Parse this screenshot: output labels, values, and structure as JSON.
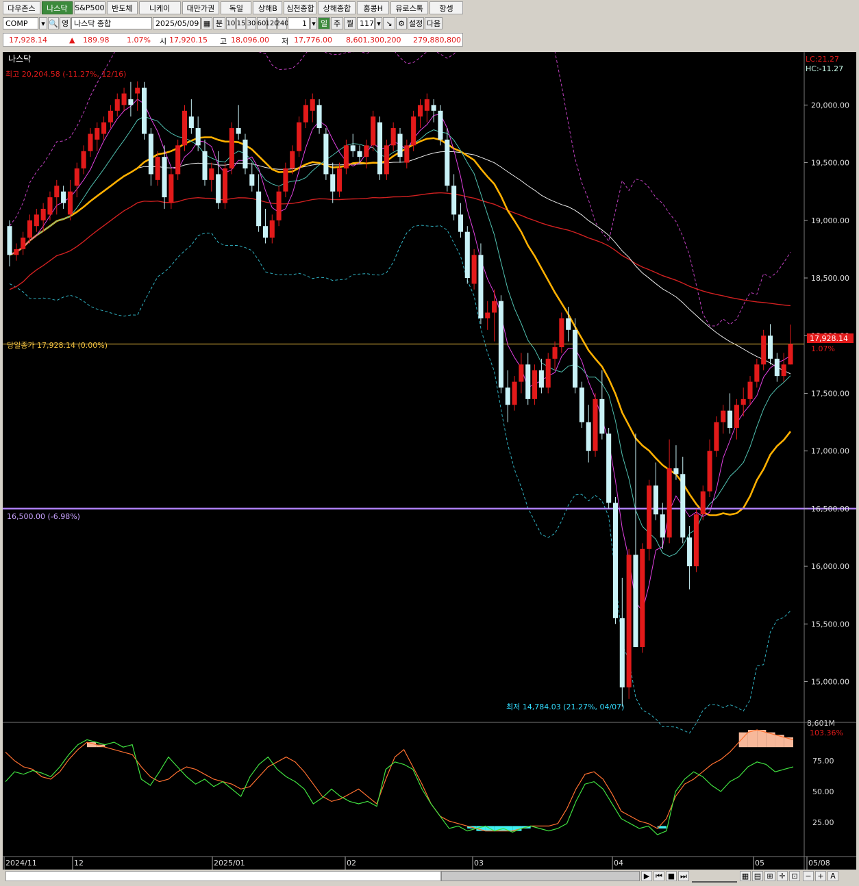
{
  "tabs": [
    {
      "label": "다우존스",
      "w": 56
    },
    {
      "label": "나스닥",
      "w": 46,
      "active": true
    },
    {
      "label": "S&P500",
      "w": 46
    },
    {
      "label": "반도체",
      "w": 46
    },
    {
      "label": "니케이",
      "w": 62
    },
    {
      "label": "대만가권",
      "w": 56
    },
    {
      "label": "독일",
      "w": 46
    },
    {
      "label": "상해B",
      "w": 44
    },
    {
      "label": "심천종합",
      "w": 48
    },
    {
      "label": "상해종합",
      "w": 56
    },
    {
      "label": "홍콩H",
      "w": 48
    },
    {
      "label": "유로스톡",
      "w": 56
    },
    {
      "label": "항셍",
      "w": 50
    }
  ],
  "controls": {
    "code": "COMP",
    "lang_label": "영",
    "name": "나스닥 종합",
    "date": "2025/05/09",
    "period_label": "분",
    "minutes": [
      "10",
      "15",
      "30",
      "60",
      "120",
      "240"
    ],
    "count": "1",
    "day_label": "일",
    "week_label": "주",
    "month_label": "월",
    "bars": "117",
    "settings_label": "설정",
    "next_label": "다음"
  },
  "quote": {
    "last": "17,928.14",
    "change": "189.98",
    "change_pct": "1.07%",
    "open_label": "시",
    "open": "17,920.15",
    "high_label": "고",
    "high": "18,096.00",
    "low_label": "저",
    "low": "17,776.00",
    "volume": "8,601,300,200",
    "value": "279,880,800"
  },
  "chart": {
    "title": "나스닥",
    "lc": "LC:21.27",
    "hc": "HC:-11.27",
    "high_note": "최고 20,204.58 (-11.27%, 12/16)",
    "low_note": "최저 14,784.03 (21.27%, 04/07)",
    "close_note": "당일종가 17,928.14 (0.00%)",
    "hline_note": "16,500.00 (-6.98%)",
    "price_tag": "17,928.14",
    "price_pct": "1.07%",
    "y_labels": [
      "20,000.00",
      "19,500.00",
      "19,000.00",
      "18,500.00",
      "18,000.00",
      "17,500.00",
      "17,000.00",
      "16,500.00",
      "16,000.00",
      "15,500.00",
      "15,000.00"
    ],
    "y_values": [
      20000,
      19500,
      19000,
      18500,
      18000,
      17500,
      17000,
      16500,
      16000,
      15500,
      15000
    ],
    "x_labels": [
      "2024/11",
      "12",
      "2025/01",
      "02",
      "03",
      "04",
      "05",
      "05/08"
    ],
    "osc_labels": [
      "75.00",
      "50.00",
      "25.00"
    ],
    "osc_top": "8,601M",
    "osc_pct": "103.36%"
  },
  "chart_data": {
    "type": "candlestick",
    "title": "나스닥",
    "ylim": [
      14700,
      20400
    ],
    "hline": 16500,
    "last_close": 17928.14,
    "candles": [
      [
        18950,
        19000,
        18600,
        18700
      ],
      [
        18700,
        18800,
        18650,
        18750
      ],
      [
        18750,
        18900,
        18700,
        18850
      ],
      [
        18850,
        19050,
        18800,
        19000
      ],
      [
        18950,
        19100,
        18900,
        19050
      ],
      [
        19000,
        19150,
        18900,
        19100
      ],
      [
        19050,
        19250,
        19000,
        19200
      ],
      [
        19200,
        19350,
        19050,
        19300
      ],
      [
        19250,
        19300,
        19100,
        19150
      ],
      [
        19050,
        19350,
        19000,
        19250
      ],
      [
        19300,
        19500,
        19200,
        19450
      ],
      [
        19450,
        19650,
        19400,
        19600
      ],
      [
        19600,
        19800,
        19550,
        19750
      ],
      [
        19700,
        19850,
        19600,
        19800
      ],
      [
        19750,
        19900,
        19700,
        19850
      ],
      [
        19850,
        20000,
        19800,
        19950
      ],
      [
        19950,
        20100,
        19900,
        20050
      ],
      [
        20000,
        20150,
        19950,
        20100
      ],
      [
        20050,
        20200,
        19900,
        20000
      ],
      [
        20100,
        20205,
        19950,
        20150
      ],
      [
        20150,
        20200,
        19700,
        19750
      ],
      [
        19750,
        19800,
        19300,
        19400
      ],
      [
        19350,
        19600,
        19300,
        19550
      ],
      [
        19550,
        19650,
        19100,
        19200
      ],
      [
        19150,
        19450,
        19100,
        19400
      ],
      [
        19400,
        19700,
        19350,
        19650
      ],
      [
        19650,
        20000,
        19600,
        19950
      ],
      [
        19900,
        20050,
        19750,
        19800
      ],
      [
        19800,
        19900,
        19600,
        19650
      ],
      [
        19600,
        19700,
        19300,
        19350
      ],
      [
        19350,
        19500,
        19250,
        19450
      ],
      [
        19400,
        19600,
        19100,
        19150
      ],
      [
        19150,
        19500,
        19100,
        19450
      ],
      [
        19450,
        19850,
        19400,
        19800
      ],
      [
        19800,
        20000,
        19700,
        19750
      ],
      [
        19700,
        19750,
        19400,
        19450
      ],
      [
        19400,
        19500,
        19250,
        19300
      ],
      [
        19250,
        19400,
        18900,
        18950
      ],
      [
        18950,
        19100,
        18800,
        18850
      ],
      [
        18850,
        19050,
        18800,
        19000
      ],
      [
        19000,
        19300,
        18950,
        19250
      ],
      [
        19250,
        19500,
        19200,
        19450
      ],
      [
        19450,
        19650,
        19400,
        19600
      ],
      [
        19600,
        19900,
        19550,
        19850
      ],
      [
        19850,
        20050,
        19800,
        20000
      ],
      [
        19950,
        20100,
        19850,
        20050
      ],
      [
        20000,
        20050,
        19750,
        19800
      ],
      [
        19750,
        19800,
        19350,
        19400
      ],
      [
        19400,
        19500,
        19150,
        19250
      ],
      [
        19250,
        19500,
        19200,
        19450
      ],
      [
        19450,
        19700,
        19400,
        19650
      ],
      [
        19650,
        19750,
        19550,
        19600
      ],
      [
        19600,
        19650,
        19500,
        19550
      ],
      [
        19550,
        19700,
        19450,
        19650
      ],
      [
        19650,
        19950,
        19600,
        19900
      ],
      [
        19850,
        19900,
        19350,
        19400
      ],
      [
        19400,
        19700,
        19350,
        19650
      ],
      [
        19650,
        19850,
        19600,
        19800
      ],
      [
        19750,
        19800,
        19500,
        19550
      ],
      [
        19500,
        19700,
        19450,
        19650
      ],
      [
        19650,
        19950,
        19600,
        19900
      ],
      [
        19900,
        20050,
        19800,
        20000
      ],
      [
        19950,
        20100,
        19850,
        20050
      ],
      [
        20000,
        20050,
        19850,
        19950
      ],
      [
        19950,
        20000,
        19650,
        19700
      ],
      [
        19700,
        19800,
        19250,
        19300
      ],
      [
        19300,
        19400,
        19000,
        19050
      ],
      [
        19050,
        19150,
        18850,
        18900
      ],
      [
        18900,
        18950,
        18450,
        18500
      ],
      [
        18450,
        18750,
        18400,
        18700
      ],
      [
        18700,
        18800,
        18100,
        18150
      ],
      [
        18150,
        18300,
        18050,
        18200
      ],
      [
        18200,
        18400,
        17950,
        18300
      ],
      [
        18300,
        18350,
        17500,
        17550
      ],
      [
        17550,
        17700,
        17250,
        17400
      ],
      [
        17400,
        17650,
        17350,
        17600
      ],
      [
        17600,
        17850,
        17500,
        17750
      ],
      [
        17750,
        17850,
        17400,
        17450
      ],
      [
        17450,
        17750,
        17400,
        17700
      ],
      [
        17700,
        17800,
        17500,
        17550
      ],
      [
        17550,
        17850,
        17500,
        17800
      ],
      [
        17800,
        17950,
        17700,
        17900
      ],
      [
        17900,
        18200,
        17850,
        18150
      ],
      [
        18150,
        18250,
        17950,
        18050
      ],
      [
        18050,
        18150,
        17500,
        17550
      ],
      [
        17550,
        17600,
        17200,
        17250
      ],
      [
        17250,
        17400,
        16900,
        17000
      ],
      [
        17000,
        17500,
        16950,
        17450
      ],
      [
        17450,
        17700,
        17100,
        17150
      ],
      [
        17150,
        17200,
        16500,
        16550
      ],
      [
        16550,
        16600,
        15500,
        15550
      ],
      [
        15550,
        15900,
        14784,
        14950
      ],
      [
        14950,
        16150,
        14850,
        16100
      ],
      [
        16100,
        17150,
        15300,
        15300
      ],
      [
        15300,
        16200,
        15250,
        16150
      ],
      [
        16150,
        16750,
        16050,
        16700
      ],
      [
        16700,
        16900,
        16400,
        16450
      ],
      [
        16450,
        16550,
        16150,
        16250
      ],
      [
        16250,
        17100,
        16200,
        16850
      ],
      [
        16850,
        17050,
        16750,
        16800
      ],
      [
        16800,
        16950,
        16200,
        16250
      ],
      [
        16250,
        16350,
        15800,
        16000
      ],
      [
        16000,
        16500,
        15950,
        16450
      ],
      [
        16450,
        16700,
        16400,
        16650
      ],
      [
        16650,
        17100,
        16600,
        17000
      ],
      [
        17000,
        17300,
        16950,
        17250
      ],
      [
        17250,
        17400,
        17150,
        17350
      ],
      [
        17350,
        17500,
        17150,
        17200
      ],
      [
        17200,
        17450,
        17100,
        17400
      ],
      [
        17400,
        17550,
        17300,
        17450
      ],
      [
        17450,
        17650,
        17400,
        17600
      ],
      [
        17600,
        17800,
        17550,
        17750
      ],
      [
        17750,
        18050,
        17700,
        18000
      ],
      [
        18000,
        18100,
        17750,
        17800
      ],
      [
        17800,
        17850,
        17600,
        17650
      ],
      [
        17650,
        17850,
        17600,
        17750
      ],
      [
        17750,
        18096,
        17750,
        17928
      ]
    ],
    "osc_green": [
      58,
      66,
      64,
      67,
      65,
      62,
      70,
      80,
      88,
      92,
      90,
      88,
      90,
      86,
      88,
      60,
      55,
      66,
      78,
      70,
      62,
      56,
      60,
      54,
      58,
      52,
      46,
      62,
      72,
      78,
      68,
      62,
      58,
      52,
      40,
      45,
      52,
      46,
      42,
      40,
      42,
      38,
      68,
      74,
      72,
      68,
      52,
      40,
      30,
      20,
      22,
      18,
      20,
      22,
      18,
      20,
      17,
      20,
      22,
      20,
      18,
      20,
      24,
      42,
      56,
      58,
      52,
      40,
      28,
      24,
      20,
      22,
      15,
      18,
      50,
      60,
      66,
      62,
      55,
      50,
      58,
      62,
      70,
      74,
      72,
      66,
      68,
      70
    ],
    "osc_orange": [
      82,
      75,
      70,
      68,
      62,
      60,
      66,
      76,
      84,
      90,
      88,
      86,
      84,
      82,
      80,
      70,
      62,
      58,
      60,
      66,
      70,
      68,
      64,
      60,
      58,
      56,
      52,
      54,
      62,
      70,
      74,
      78,
      74,
      66,
      56,
      46,
      42,
      44,
      48,
      52,
      46,
      40,
      60,
      78,
      84,
      70,
      56,
      40,
      30,
      26,
      24,
      22,
      20,
      18,
      18,
      18,
      18,
      20,
      22,
      22,
      22,
      24,
      36,
      52,
      64,
      66,
      60,
      48,
      34,
      30,
      26,
      24,
      20,
      28,
      46,
      56,
      60,
      66,
      72,
      76,
      82,
      90,
      98,
      100,
      98,
      96,
      94,
      92
    ]
  }
}
